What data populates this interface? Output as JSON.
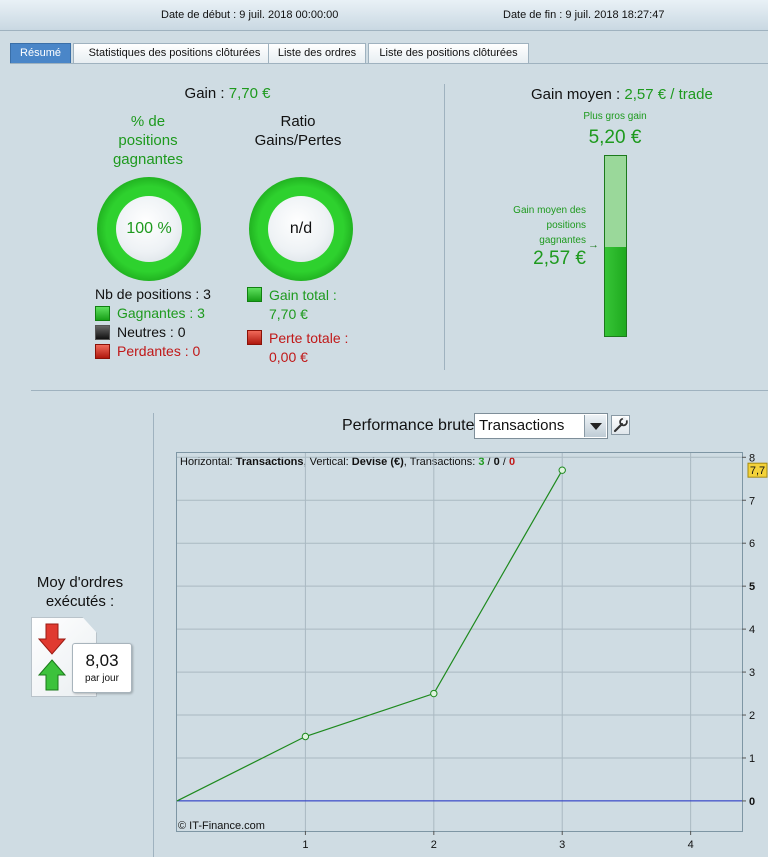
{
  "header": {
    "start_label": "Date de début :",
    "start_value": "9 juil. 2018 00:00:00",
    "end_label": "Date de fin :",
    "end_value": "9 juil. 2018 18:27:47"
  },
  "tabs": [
    {
      "label": "Résumé",
      "active": true
    },
    {
      "label": "Statistiques des positions clôturées",
      "active": false
    },
    {
      "label": "Liste des ordres",
      "active": false
    },
    {
      "label": "Liste des positions clôturées",
      "active": false
    }
  ],
  "summary": {
    "gain_label": "Gain :",
    "gain_value": "7,70 €",
    "win_pct_title": [
      "% de",
      "positions",
      "gagnantes"
    ],
    "win_pct_value": "100 %",
    "ratio_title": [
      "Ratio",
      "Gains/Pertes"
    ],
    "ratio_value": "n/d",
    "positions": {
      "total_label": "Nb de positions : 3",
      "winning_label": "Gagnantes : 3",
      "neutral_label": "Neutres : 0",
      "losing_label": "Perdantes : 0"
    },
    "totals": {
      "gain_total_label": "Gain total :",
      "gain_total_value": "7,70 €",
      "loss_total_label": "Perte totale :",
      "loss_total_value": "0,00 €"
    }
  },
  "avg_gain": {
    "label": "Gain moyen :",
    "value": "2,57 € / trade",
    "max_label": "Plus gros gain",
    "max_value": "5,20 €",
    "avg_label": [
      "Gain moyen des",
      "positions",
      "gagnantes"
    ],
    "avg_value": "2,57 €",
    "avg_fraction": 0.494
  },
  "orders": {
    "label": [
      "Moy d'ordres",
      "exécutés :"
    ],
    "value": "8,03",
    "unit": "par jour"
  },
  "performance": {
    "title": "Performance brute",
    "select_value": "Transactions"
  },
  "chart_data": {
    "type": "line",
    "header": {
      "h_label": "Horizontal: ",
      "h_value": "Transactions",
      "v_label": ", Vertical: ",
      "v_value": "Devise (€)",
      "t_label": ", Transactions: ",
      "t_win": "3",
      "t_neutral": "0",
      "t_loss": "0"
    },
    "x": [
      0,
      1,
      2,
      3
    ],
    "y": [
      0,
      1.5,
      2.5,
      7.7
    ],
    "xlim": [
      0,
      4.4
    ],
    "ylim": [
      -0.7,
      8.1
    ],
    "x_ticks": [
      "1",
      "2",
      "3",
      "4"
    ],
    "y_ticks": [
      "0",
      "1",
      "2",
      "3",
      "4",
      "5",
      "6",
      "7",
      "8"
    ],
    "last_value_label": "7,7",
    "grid": true,
    "baseline": 0,
    "line_color": "#1e8a1e",
    "baseline_color": "#2030c8",
    "credit": "© IT-Finance.com"
  }
}
